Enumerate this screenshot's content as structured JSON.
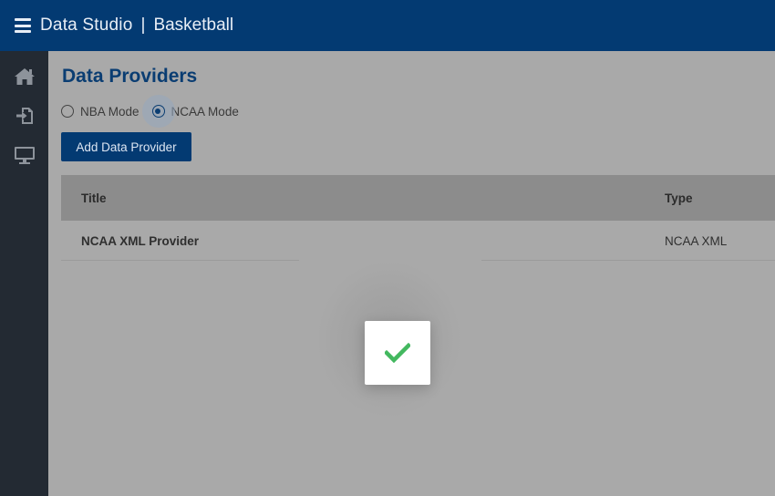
{
  "header": {
    "app_title": "Data Studio",
    "separator": "|",
    "section": "Basketball",
    "menu_icon": "hamburger-menu-icon"
  },
  "sidebar": {
    "items": [
      {
        "icon": "home-icon"
      },
      {
        "icon": "sign-in-icon"
      },
      {
        "icon": "monitor-icon"
      }
    ]
  },
  "main": {
    "title": "Data Providers",
    "modes": [
      {
        "label": "NBA Mode",
        "checked": false
      },
      {
        "label": "NCAA Mode",
        "checked": true
      }
    ],
    "add_button_label": "Add Data Provider",
    "table": {
      "columns": [
        "Title",
        "Type"
      ],
      "rows": [
        {
          "title": "NCAA XML Provider",
          "type": "NCAA XML"
        }
      ]
    }
  },
  "toast": {
    "icon": "checkmark-icon",
    "status_color": "#43b85f"
  },
  "colors": {
    "brand": "#033a72",
    "sidebar": "#232a33",
    "overlay": "#a9a9a9"
  }
}
